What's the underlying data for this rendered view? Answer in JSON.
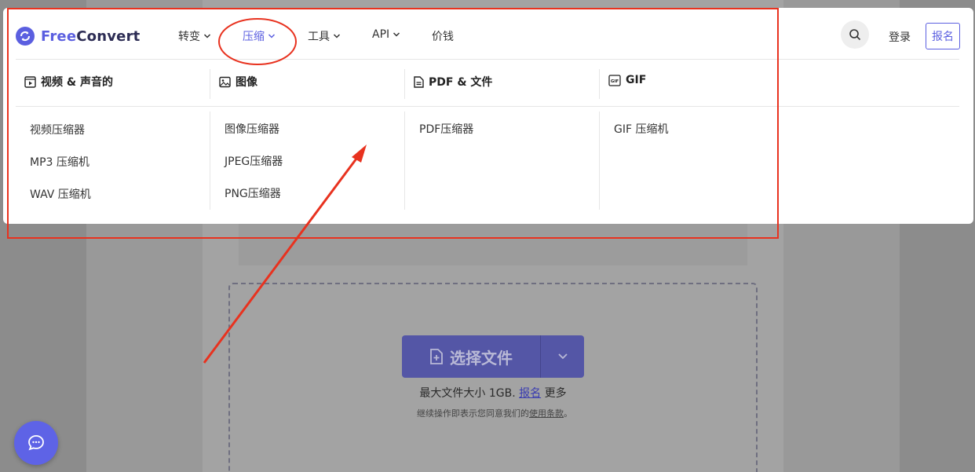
{
  "brand": {
    "name_part1": "Free",
    "name_part2": "Convert"
  },
  "nav": {
    "items": [
      {
        "label": "转变",
        "has_dropdown": true
      },
      {
        "label": "压缩",
        "has_dropdown": true,
        "active": true
      },
      {
        "label": "工具",
        "has_dropdown": true
      },
      {
        "label": "API",
        "has_dropdown": true
      },
      {
        "label": "价钱",
        "has_dropdown": false
      }
    ]
  },
  "header_actions": {
    "login": "登录",
    "signup": "报名",
    "search_icon": "search-icon"
  },
  "menu": {
    "columns": [
      {
        "title": "视频 & 声音的",
        "icon": "video-icon",
        "items": [
          "视频压缩器",
          "MP3 压缩机",
          "WAV 压缩机"
        ]
      },
      {
        "title": "图像",
        "icon": "image-icon",
        "items": [
          "图像压缩器",
          "JPEG压缩器",
          "PNG压缩器"
        ]
      },
      {
        "title": "PDF & 文件",
        "icon": "document-icon",
        "items": [
          "PDF压缩器"
        ]
      },
      {
        "title": "GIF",
        "icon": "gif-icon",
        "items": [
          "GIF 压缩机"
        ]
      }
    ]
  },
  "upload": {
    "choose_label": "选择文件",
    "max_size_prefix": "最大文件大小 1GB.",
    "max_size_link": "报名",
    "max_size_suffix": "更多",
    "terms_prefix": "继续操作即表示您同意我们的",
    "terms_link": "使用条款",
    "terms_suffix": "。"
  },
  "colors": {
    "accent": "#5b5fe0",
    "annotation": "#e8321f",
    "overlay_bg": "#8c8c8c"
  }
}
